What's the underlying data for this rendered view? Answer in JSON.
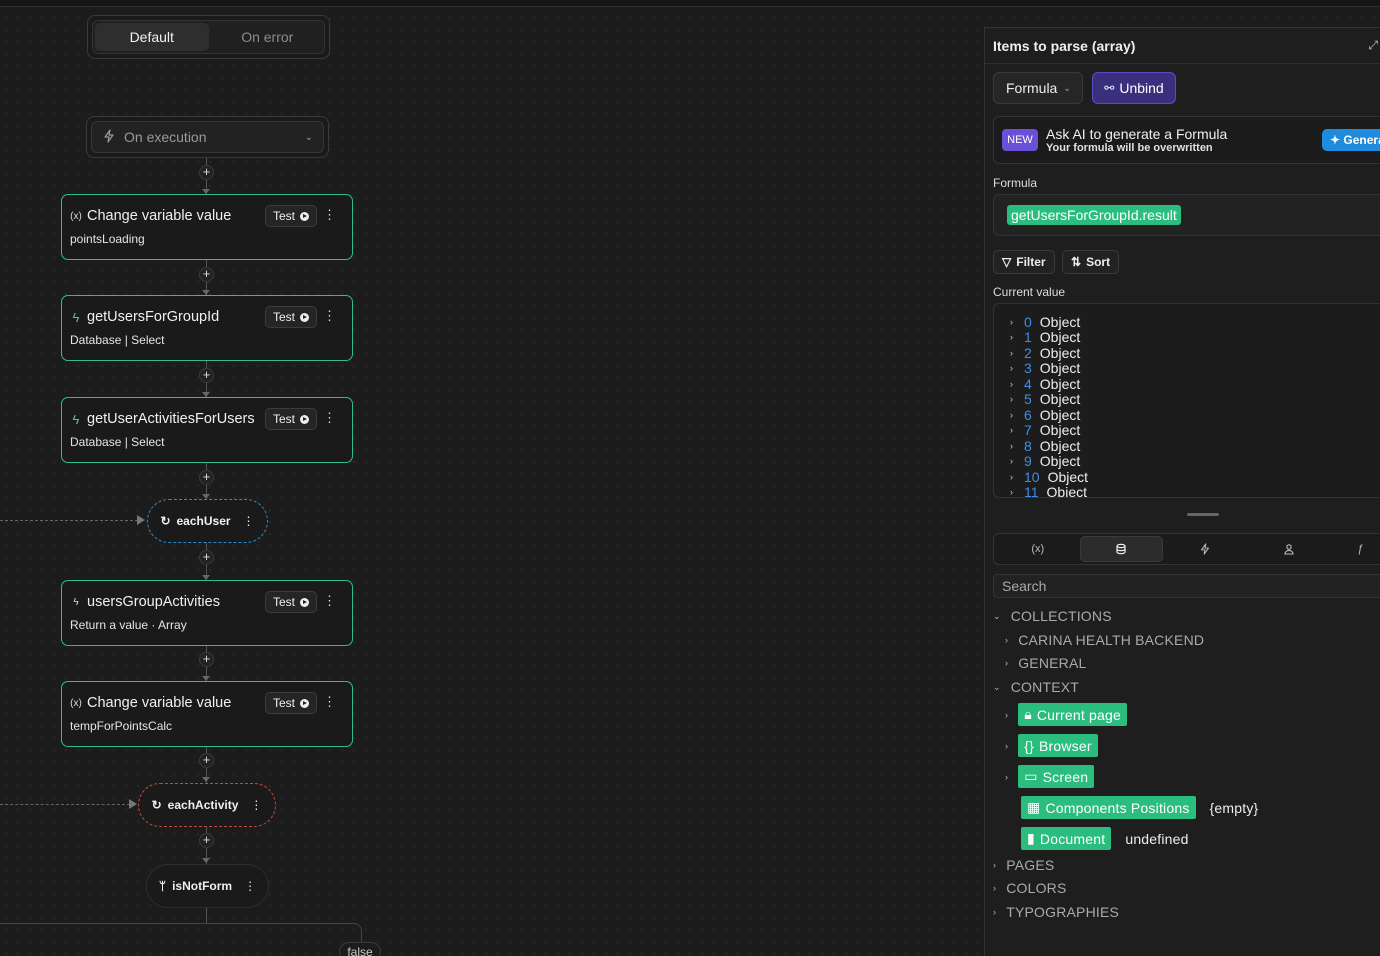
{
  "workflow": {
    "tabs": [
      "Default",
      "On error"
    ],
    "trigger": "On execution",
    "steps": [
      {
        "icon": "variable-icon",
        "title": "Change variable value",
        "subtitle": "pointsLoading",
        "test": "Test"
      },
      {
        "icon": "bolt-icon",
        "title": "getUsersForGroupId",
        "subtitle": "Database | Select",
        "test": "Test"
      },
      {
        "icon": "bolt-icon",
        "title": "getUserActivitiesForUsers",
        "subtitle": "Database | Select",
        "test": "Test"
      },
      {
        "icon": "bolt-outline-icon",
        "title": "usersGroupActivities",
        "subtitle": "Return a value · Array",
        "test": "Test"
      },
      {
        "icon": "variable-icon",
        "title": "Change variable value",
        "subtitle": "tempForPointsCalc",
        "test": "Test"
      }
    ],
    "loops": [
      "eachUser",
      "eachActivity"
    ],
    "branch": "isNotForm",
    "branch_false": "false"
  },
  "panel": {
    "title": "Items to parse (array)",
    "formula_btn": "Formula",
    "unbind_btn": "Unbind",
    "ai": {
      "badge": "NEW",
      "title": "Ask AI to generate a Formula",
      "subtitle": "Your formula will be overwritten",
      "button": "Genera"
    },
    "formula_label": "Formula",
    "formula_value": "getUsersForGroupId.result",
    "filter_btn": "Filter",
    "sort_btn": "Sort",
    "current_value_label": "Current value",
    "items": [
      {
        "index": "0",
        "value": "Object"
      },
      {
        "index": "1",
        "value": "Object"
      },
      {
        "index": "2",
        "value": "Object"
      },
      {
        "index": "3",
        "value": "Object"
      },
      {
        "index": "4",
        "value": "Object"
      },
      {
        "index": "5",
        "value": "Object"
      },
      {
        "index": "6",
        "value": "Object"
      },
      {
        "index": "7",
        "value": "Object"
      },
      {
        "index": "8",
        "value": "Object"
      },
      {
        "index": "9",
        "value": "Object"
      },
      {
        "index": "10",
        "value": "Object"
      },
      {
        "index": "11",
        "value": "Object"
      }
    ],
    "search_placeholder": "Search",
    "tree": {
      "collections": "COLLECTIONS",
      "carina": "CARINA HEALTH BACKEND",
      "general": "GENERAL",
      "context": "CONTEXT",
      "current_page": "Current page",
      "browser": "Browser",
      "screen": "Screen",
      "components_positions": "Components Positions",
      "components_value": "{empty}",
      "document": "Document",
      "document_value": "undefined",
      "pages": "PAGES",
      "colors": "COLORS",
      "typographies": "TYPOGRAPHIES"
    }
  },
  "colors": {
    "accent_green": "#2bbd7e",
    "unbind_purple": "#3a2f7d",
    "loop_blue": "#2a8bd1",
    "loop_red": "#c6493d",
    "ai_blue": "#1f8bdc"
  }
}
